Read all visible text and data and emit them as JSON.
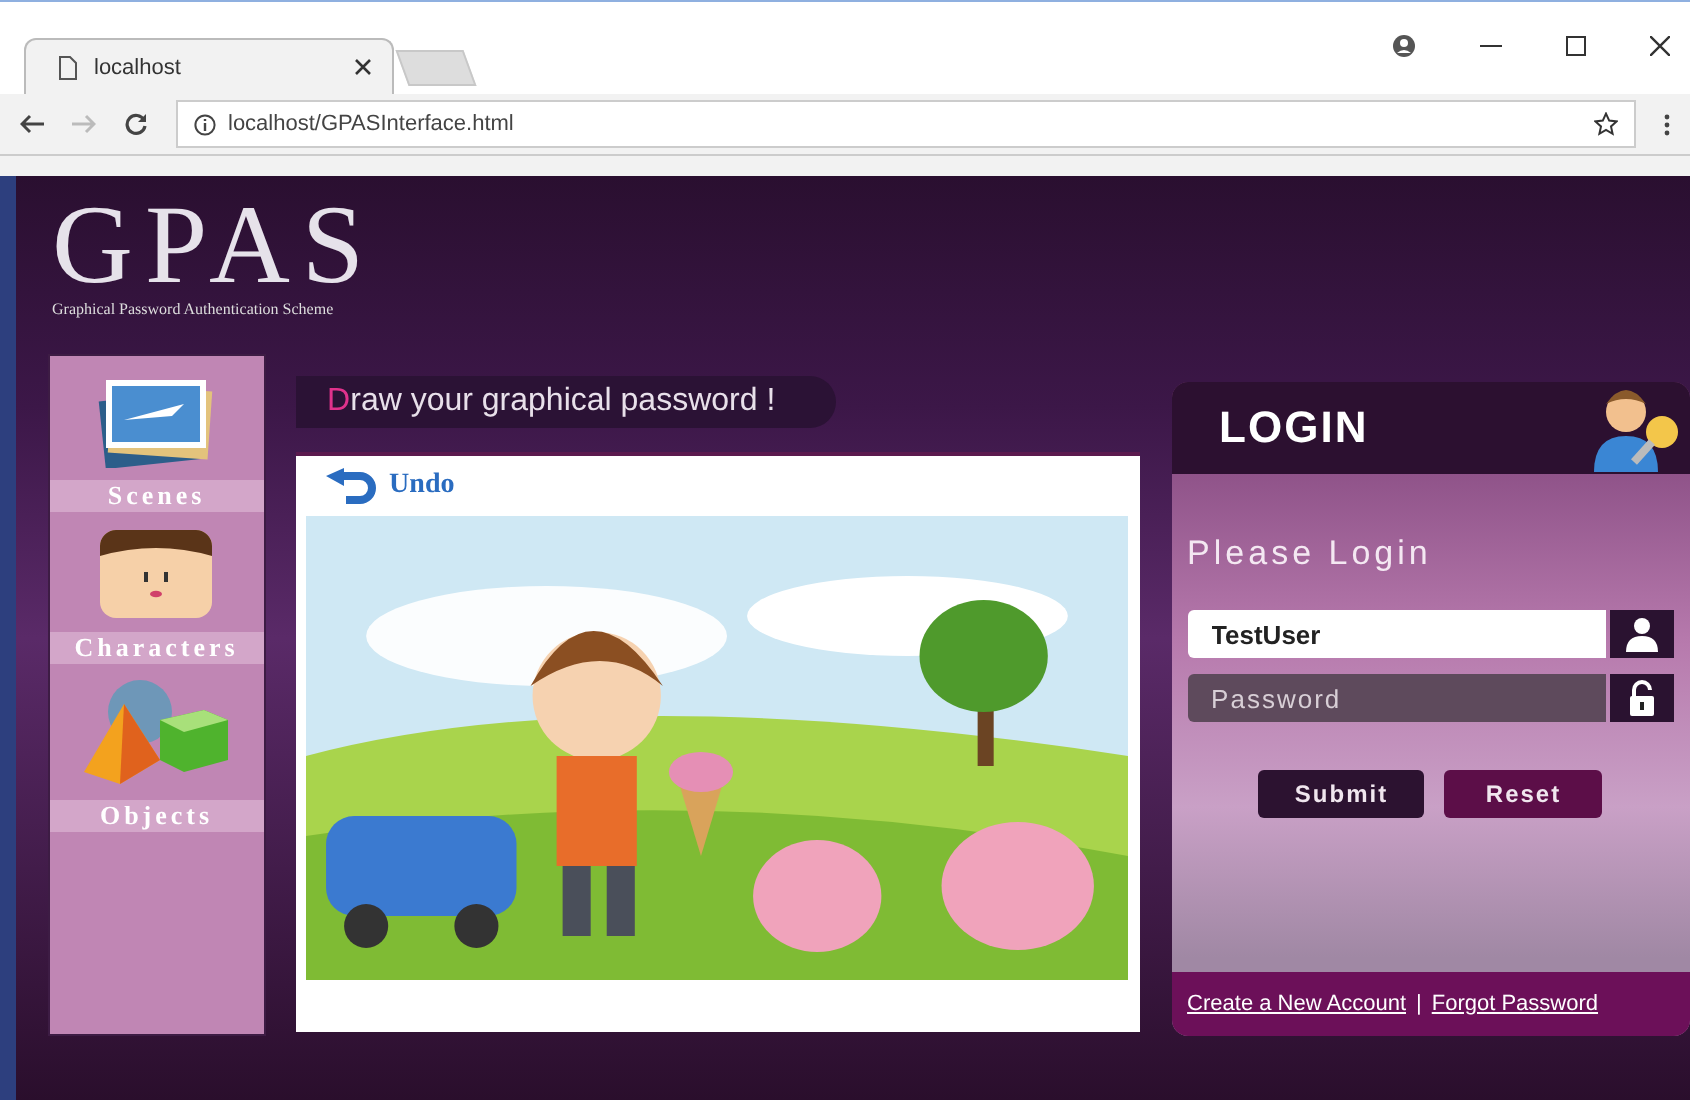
{
  "browser": {
    "tab_title": "localhost",
    "url": "localhost/GPASInterface.html"
  },
  "logo": {
    "title": "GPAS",
    "subtitle": "Graphical Password Authentication Scheme"
  },
  "sidebar": {
    "items": [
      {
        "label": "Scenes",
        "kind": "scenes"
      },
      {
        "label": "Characters",
        "kind": "characters"
      },
      {
        "label": "Objects",
        "kind": "objects"
      }
    ]
  },
  "canvas": {
    "prompt": "Draw your graphical password !",
    "undo": "Undo"
  },
  "login": {
    "title": "LOGIN",
    "heading": "Please Login",
    "username": {
      "value": "TestUser"
    },
    "password": {
      "placeholder": "Password"
    },
    "buttons": [
      {
        "label": "Submit",
        "kind": "submit"
      },
      {
        "label": "Reset",
        "kind": "reset"
      }
    ],
    "links": [
      "Create a New Account",
      "Forgot Password"
    ],
    "separator": "|"
  }
}
